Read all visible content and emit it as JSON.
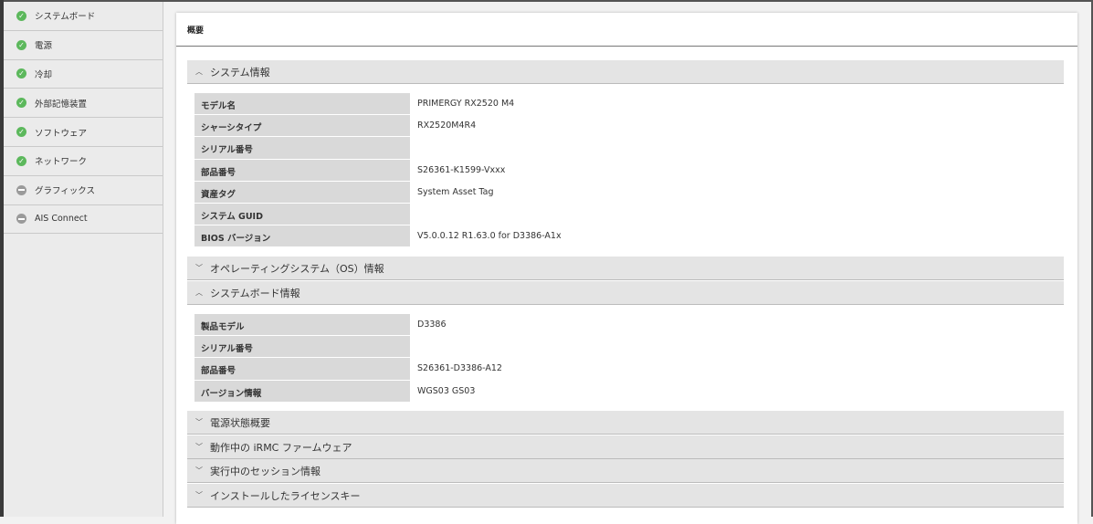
{
  "sidebar": {
    "items": [
      {
        "label": "システムボード",
        "status": "ok"
      },
      {
        "label": "電源",
        "status": "ok"
      },
      {
        "label": "冷却",
        "status": "ok"
      },
      {
        "label": "外部記憶装置",
        "status": "ok"
      },
      {
        "label": "ソフトウェア",
        "status": "ok"
      },
      {
        "label": "ネットワーク",
        "status": "ok"
      },
      {
        "label": "グラフィックス",
        "status": "na"
      },
      {
        "label": "AIS Connect",
        "status": "na"
      }
    ]
  },
  "panel": {
    "title": "概要"
  },
  "sections": {
    "system_info": {
      "label": "システム情報",
      "rows": [
        {
          "label": "モデル名",
          "value": "PRIMERGY RX2520 M4"
        },
        {
          "label": "シャーシタイプ",
          "value": "RX2520M4R4"
        },
        {
          "label": "シリアル番号",
          "value": ""
        },
        {
          "label": "部品番号",
          "value": "S26361-K1599-Vxxx"
        },
        {
          "label": "資産タグ",
          "value": "System Asset Tag"
        },
        {
          "label": "システム GUID",
          "value": ""
        },
        {
          "label": "BIOS バージョン",
          "value": "V5.0.0.12 R1.63.0 for D3386-A1x"
        }
      ]
    },
    "os_info": {
      "label": "オペレーティングシステム（OS）情報"
    },
    "board_info": {
      "label": "システムボード情報",
      "rows": [
        {
          "label": "製品モデル",
          "value": "D3386"
        },
        {
          "label": "シリアル番号",
          "value": ""
        },
        {
          "label": "部品番号",
          "value": "S26361-D3386-A12"
        },
        {
          "label": "バージョン情報",
          "value": "WGS03 GS03"
        }
      ]
    },
    "power": {
      "label": "電源状態概要"
    },
    "firmware": {
      "label": "動作中の iRMC ファームウェア"
    },
    "sessions": {
      "label": "実行中のセッション情報"
    },
    "license": {
      "label": "インストールしたライセンスキー"
    }
  }
}
